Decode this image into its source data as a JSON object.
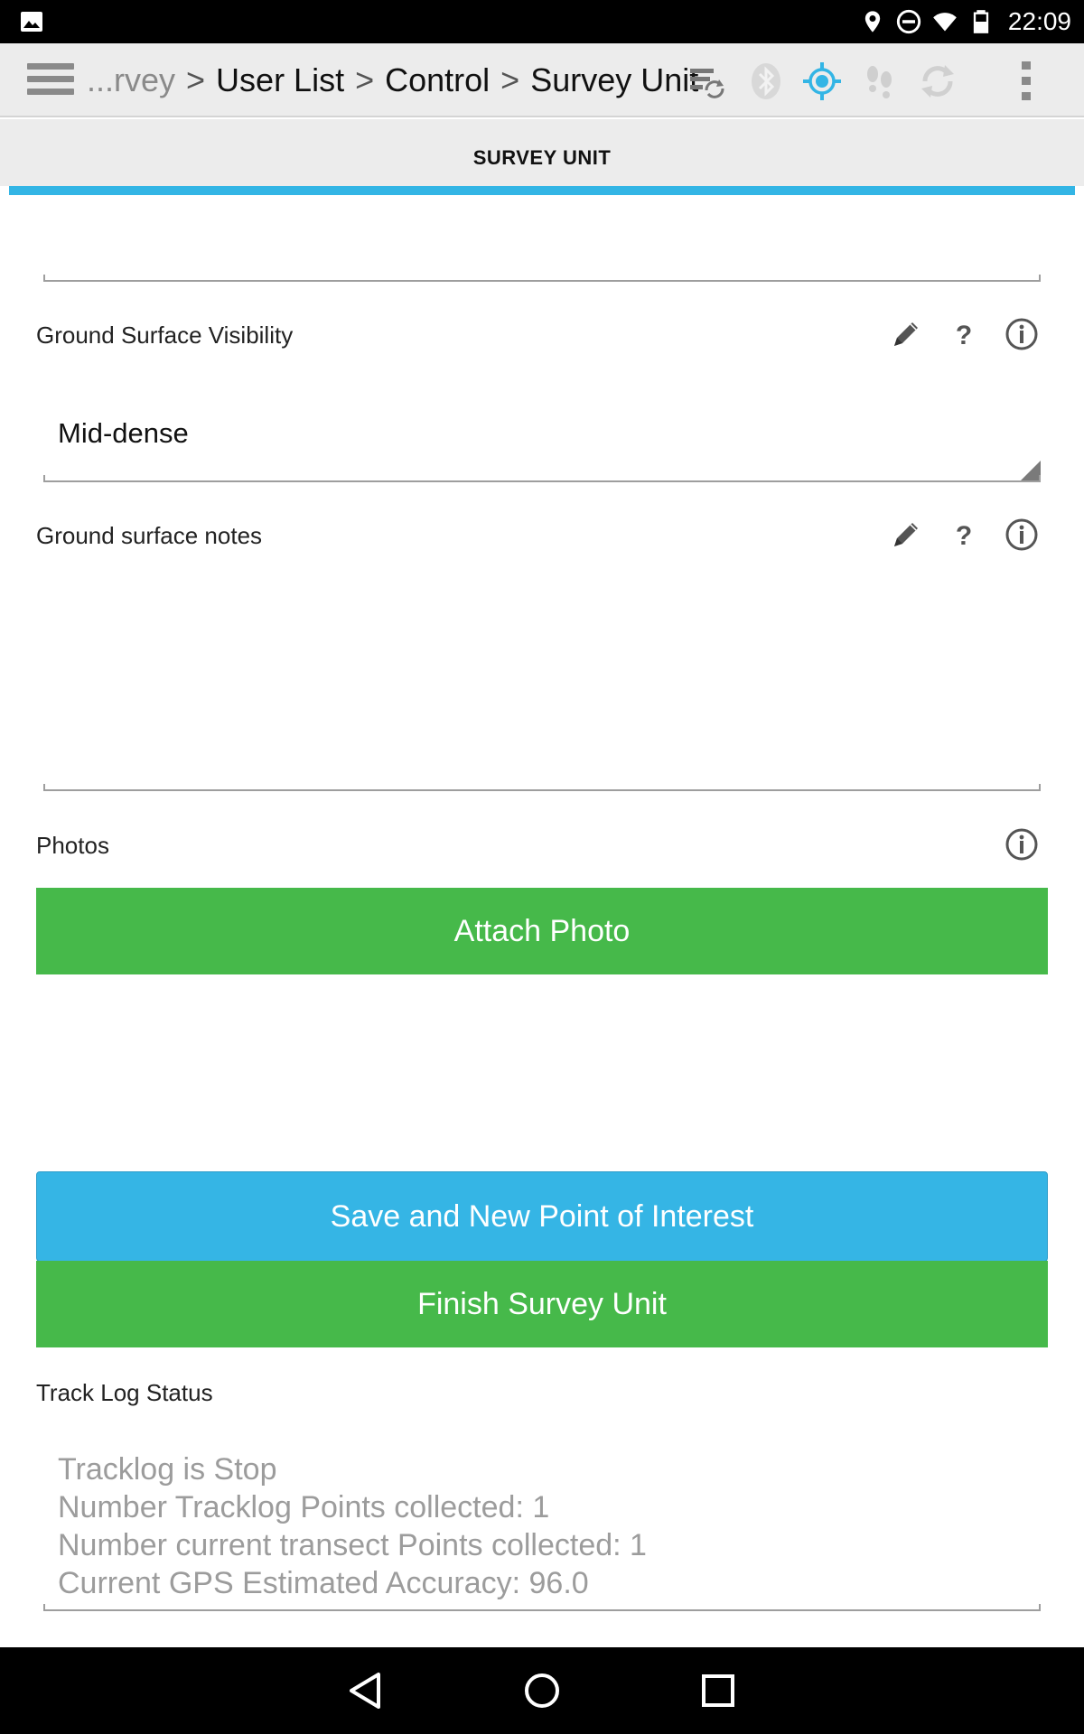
{
  "status_bar": {
    "time": "22:09",
    "icons": [
      "image-icon",
      "location-icon",
      "do-not-disturb-icon",
      "wifi-icon",
      "battery-icon"
    ]
  },
  "action_bar": {
    "breadcrumb_prefix": "...rvey",
    "breadcrumb_items": [
      "User List",
      "Control",
      "Survey Unit"
    ],
    "separator": ">",
    "icons": [
      "menu-icon",
      "sync-list-icon",
      "bluetooth-icon",
      "gps-target-icon",
      "footsteps-icon",
      "refresh-icon",
      "overflow-menu-icon"
    ],
    "accent_color": "#33b5e5"
  },
  "tab": {
    "label": "SURVEY UNIT",
    "indicator_color": "#33b5e5"
  },
  "form": {
    "ground_visibility": {
      "label": "Ground Surface Visibility",
      "value": "Mid-dense"
    },
    "ground_notes": {
      "label": "Ground surface notes",
      "value": ""
    },
    "photos": {
      "label": "Photos",
      "attach_button": "Attach Photo"
    },
    "save_button": "Save and New Point of Interest",
    "finish_button": "Finish Survey Unit",
    "track_log": {
      "label": "Track Log Status",
      "lines": [
        "Tracklog is Stop",
        "Number Tracklog Points collected: 1",
        "Number current transect Points collected: 1",
        "Current GPS Estimated Accuracy: 96.0"
      ]
    }
  },
  "colors": {
    "green_button": "#46b94a",
    "blue_button": "#35b5e5"
  },
  "nav_bar": {
    "icons": [
      "back-icon",
      "home-icon",
      "recents-icon"
    ]
  }
}
